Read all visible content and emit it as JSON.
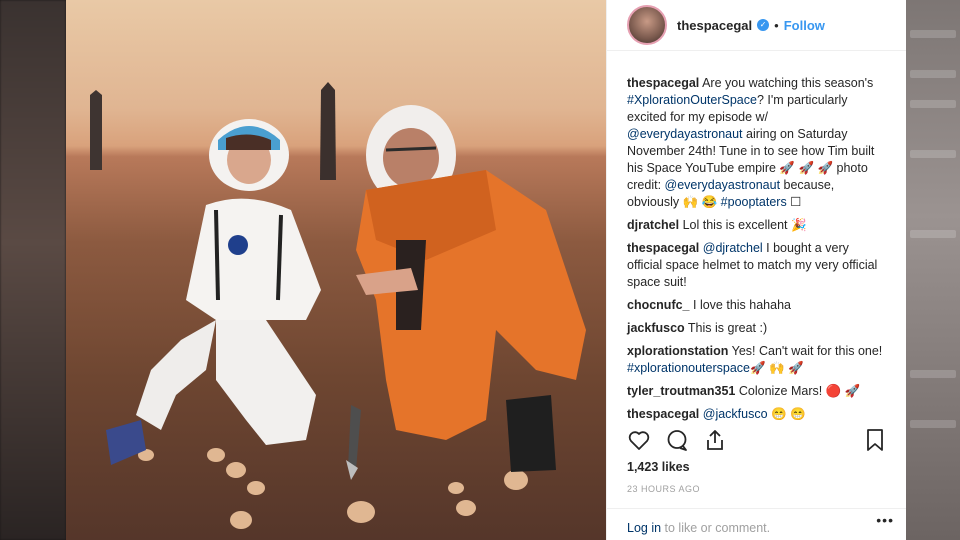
{
  "post": {
    "username": "thespacegal",
    "follow_label": "Follow",
    "dot": "•",
    "caption": {
      "user": "thespacegal",
      "text_1": "Are you watching this season's ",
      "hashtag_1": "#XplorationOuterSpace",
      "text_2": "? I'm particularly excited for my episode w/ ",
      "mention_1": "@everydayastronaut",
      "text_3": " airing on Saturday November 24th! Tune in to see how Tim built his Space YouTube empire 🚀 🚀 🚀 photo credit: ",
      "mention_2": "@everydayastronaut",
      "text_4": " because, obviously 🙌 😂 ",
      "hashtag_2": "#pooptaters",
      "text_5": " ☐"
    },
    "comments": [
      {
        "user": "djratchel",
        "text": "Lol this is excellent 🎉"
      },
      {
        "user": "thespacegal",
        "mention": "@djratchel",
        "text": " I bought a very official space helmet to match my very official space suit!"
      },
      {
        "user": "chocnufc_",
        "text": "I love this hahaha"
      },
      {
        "user": "jackfusco",
        "text": "This is great :)"
      },
      {
        "user": "xplorationstation",
        "text": "Yes! Can't wait for this one! ",
        "hashtag": "#xplorationouterspace",
        "text_after": "🚀 🙌 🚀"
      },
      {
        "user": "tyler_troutman351",
        "text": "Colonize Mars! 🔴 🚀"
      },
      {
        "user": "thespacegal",
        "mention": "@jackfusco",
        "text": " 😁 😁"
      }
    ],
    "likes": "1,423 likes",
    "timestamp": "23 HOURS AGO",
    "login_link": "Log in",
    "login_text": " to like or comment.",
    "more_label": "•••",
    "icons": [
      "heart-icon",
      "comment-icon",
      "share-icon",
      "bookmark-icon"
    ]
  }
}
